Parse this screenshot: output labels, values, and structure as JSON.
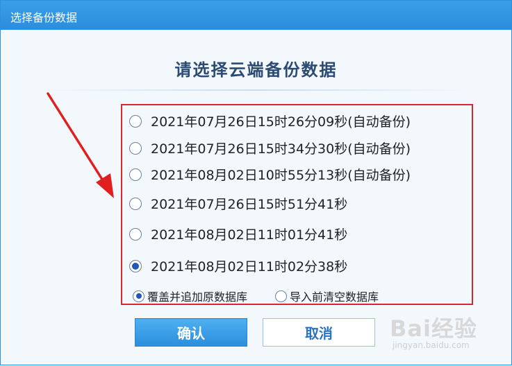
{
  "window": {
    "title": "选择备份数据"
  },
  "heading": "请选择云端备份数据",
  "backups": [
    {
      "label": "2021年07月26日15时26分09秒(自动备份)",
      "selected": false
    },
    {
      "label": "2021年07月26日15时34分30秒(自动备份)",
      "selected": false
    },
    {
      "label": "2021年08月02日10时55分13秒(自动备份)",
      "selected": false
    },
    {
      "label": "2021年07月26日15时51分41秒",
      "selected": false
    },
    {
      "label": "2021年08月02日11时01分41秒",
      "selected": false
    },
    {
      "label": "2021年08月02日11时02分38秒",
      "selected": true
    }
  ],
  "import_mode": [
    {
      "label": "覆盖并追加原数据库",
      "selected": true
    },
    {
      "label": "导入前清空数据库",
      "selected": false
    }
  ],
  "buttons": {
    "ok": "确认",
    "cancel": "取消"
  },
  "watermark": {
    "brand": "Bai经验",
    "url": "jingyan.baidu.com"
  },
  "colors": {
    "titlebar": "#2b8ddc",
    "highlight_box": "#d8262c",
    "arrow": "#e02020",
    "heading": "#2b4a74"
  }
}
